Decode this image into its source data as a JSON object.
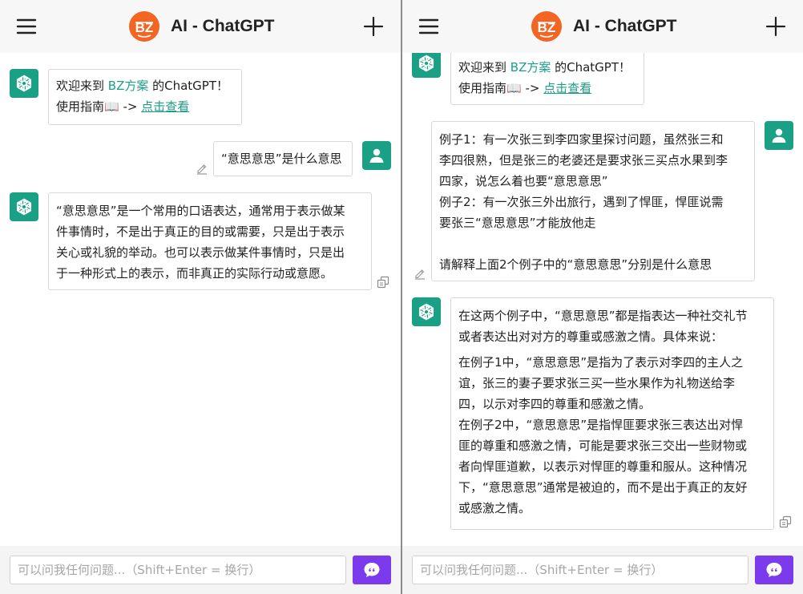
{
  "header": {
    "title": "AI - ChatGPT",
    "logo_text": "BZ",
    "menu_icon": "hamburger-menu-icon",
    "new_icon": "plus-icon"
  },
  "colors": {
    "accent_green": "#1aa084",
    "logo_orange": "#f26522",
    "send_purple": "#7c3aed"
  },
  "input": {
    "placeholder": "可以问我任何问题...（Shift+Enter = 换行）"
  },
  "left": {
    "welcome": {
      "pre": "欢迎来到 ",
      "brand": "BZ方案",
      "post": " 的ChatGPT！",
      "guide_pre": "使用指南📖 -> ",
      "guide_link": "点击查看"
    },
    "user_q": "“意思意思”是什么意思",
    "answer": [
      "“意思意思”是一个常用的口语表达，通常用于表示做某",
      "件事情时，不是出于真正的目的或需要，只是出于表示",
      "关心或礼貌的举动。也可以表示做某件事情时，只是出",
      "于一种形式上的表示，而非真正的实际行动或意愿。"
    ]
  },
  "right": {
    "welcome": {
      "pre": "欢迎来到 ",
      "brand": "BZ方案",
      "post": " 的ChatGPT！",
      "guide_pre": "使用指南📖 -> ",
      "guide_link": "点击查看"
    },
    "user_q": [
      "例子1：有一次张三到李四家里探讨问题，虽然张三和",
      "李四很熟，但是张三的老婆还是要求张三买点水果到李",
      "四家，说怎么着也要“意思意思”",
      "例子2：有一次张三外出旅行，遇到了悍匪，悍匪说需",
      "要张三“意思意思”才能放他走",
      "",
      "请解释上面2个例子中的“意思意思”分别是什么意思"
    ],
    "answer_intro": [
      "在这两个例子中，“意思意思”都是指表达一种社交礼节",
      "或者表达出对对方的尊重或感激之情。具体来说："
    ],
    "answer_body": [
      "在例子1中，“意思意思”是指为了表示对李四的主人之",
      "谊，张三的妻子要求张三买一些水果作为礼物送给李",
      "四，以示对李四的尊重和感激之情。",
      "在例子2中，“意思意思”是指悍匪要求张三表达出对悍",
      "匪的尊重和感激之情，可能是要求张三交出一些财物或",
      "者向悍匪道歉，以表示对悍匪的尊重和服从。这种情况",
      "下，“意思意思”通常是被迫的，而不是出于真正的友好",
      "或感激之情。"
    ]
  },
  "icons": {
    "bot_avatar": "openai-logo-icon",
    "user_avatar": "user-icon",
    "edit": "pencil-edit-icon",
    "copy": "copy-icon",
    "send": "chat-bubble-send-icon"
  }
}
